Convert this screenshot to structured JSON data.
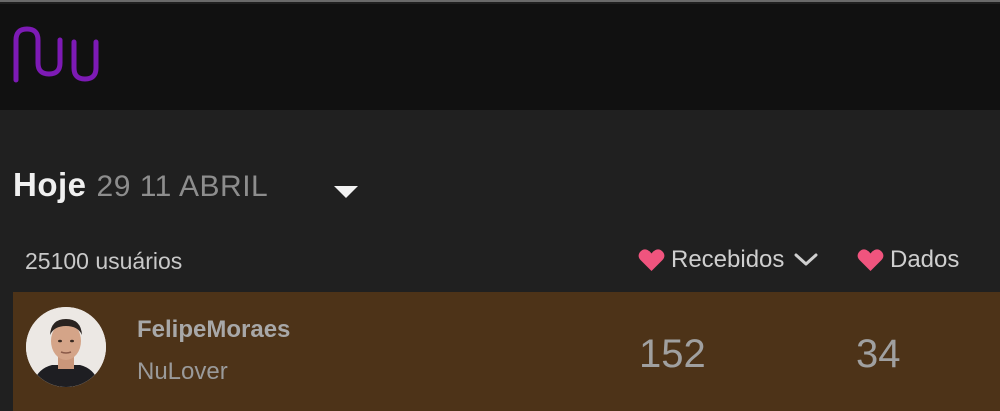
{
  "brand": {
    "logo_text": "nu",
    "accent_color": "#8a1fc8"
  },
  "header": {
    "today_label": "Hoje",
    "date_label": "29 11 ABRIL",
    "dropdown_icon": "caret-down-icon"
  },
  "columns": {
    "users_count": "25100 usuários",
    "received_label": "Recebidos",
    "received_sort_icon": "chevron-down-icon",
    "given_label": "Dados",
    "heart_icon": "heart-icon",
    "heart_color": "#f0547e"
  },
  "rows": [
    {
      "name": "FelipeMoraes",
      "badge": "NuLover",
      "received": "152",
      "given": "34",
      "row_color": "#4d3318"
    }
  ]
}
